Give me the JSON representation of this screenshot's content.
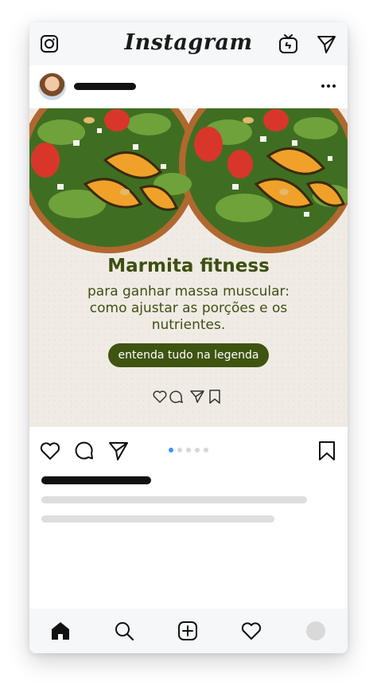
{
  "app": {
    "logo_text": "Instagram"
  },
  "topbar": {
    "icons": [
      "camera-icon",
      "igtv-icon",
      "direct-send-icon"
    ]
  },
  "post": {
    "image": {
      "title": "Marmita fitness",
      "subtitle": "para ganhar massa muscular: como ajustar as porções e os nutrientes.",
      "cta": "entenda tudo na legenda",
      "mini_icons": [
        "heart-icon",
        "comment-icon",
        "send-icon",
        "bookmark-icon"
      ]
    },
    "carousel": {
      "count": 5,
      "active_index": 0
    },
    "colors": {
      "title": "#3d4f12",
      "pill": "#3e5410",
      "carousel_active": "#3897f0"
    }
  },
  "actions": {
    "icons": [
      "like-heart-icon",
      "comment-bubble-icon",
      "share-send-icon",
      "bookmark-icon"
    ]
  },
  "bottomnav": {
    "icons": [
      "home-icon",
      "search-icon",
      "add-post-icon",
      "activity-heart-icon",
      "profile-avatar"
    ]
  }
}
